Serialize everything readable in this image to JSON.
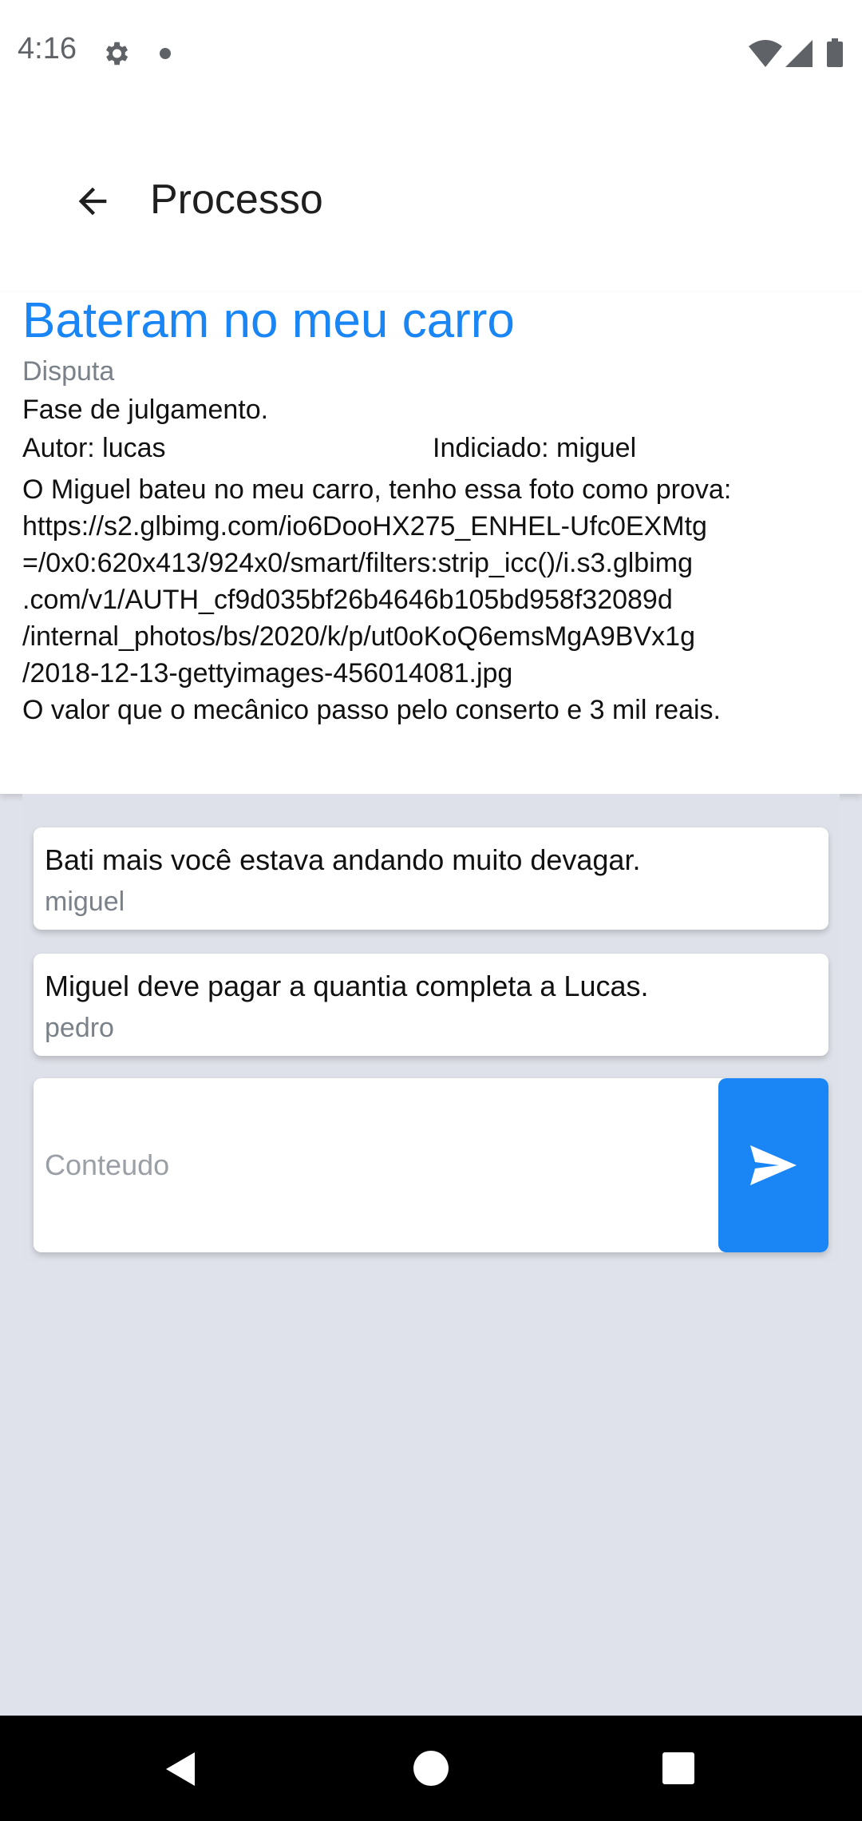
{
  "status_bar": {
    "time": "4:16",
    "icons": [
      "gear-icon",
      "notification-dot-icon",
      "wifi-icon",
      "signal-icon",
      "battery-icon"
    ]
  },
  "app_bar": {
    "title": "Processo",
    "back_icon": "arrow-left-icon"
  },
  "process": {
    "title": "Bateram no meu carro",
    "type": "Disputa",
    "phase": "Fase de julgamento.",
    "author": "Autor: lucas",
    "accused": "Indiciado: miguel",
    "description_lines": [
      "O Miguel bateu no meu carro, tenho essa foto como prova:",
      "https://s2.glbimg.com/io6DooHX275_ENHEL-Ufc0EXMtg",
      "=/0x0:620x413/924x0/smart/filters:strip_icc()/i.s3.glbimg",
      ".com/v1/AUTH_cf9d035bf26b4646b105bd958f32089d",
      "/internal_photos/bs/2020/k/p/ut0oKoQ6emsMgA9BVx1g",
      "/2018-12-13-gettyimages-456014081.jpg",
      "O valor que o mecânico passo pelo conserto e 3 mil reais."
    ]
  },
  "comments": [
    {
      "text": "Bati mais você estava andando muito devagar.",
      "author": "miguel"
    },
    {
      "text": "Miguel deve pagar a quantia completa a Lucas.",
      "author": "pedro"
    }
  ],
  "composer": {
    "placeholder": "Conteudo",
    "value": "",
    "send_icon": "send-icon"
  },
  "colors": {
    "accent": "#1a86f5",
    "background": "#e0e2eb",
    "muted_text": "#7b8189"
  },
  "nav_bar": {
    "icons": [
      "back-triangle-icon",
      "home-circle-icon",
      "recents-square-icon"
    ]
  }
}
